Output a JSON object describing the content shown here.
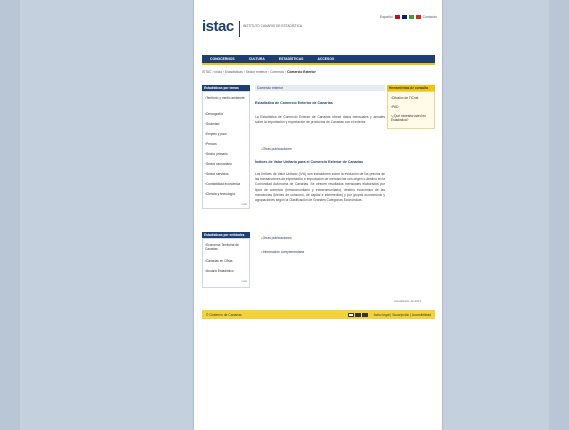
{
  "header": {
    "logo": "istac",
    "institute": "INSTITUTO CANARIO DE ESTADÍSTICA",
    "lang_links": "Español",
    "contact": "Contacto"
  },
  "topnav": [
    "Conocernos",
    "Cultura",
    "Estadísticas",
    "Accesos"
  ],
  "breadcrumb": {
    "trail": "ISTAC › Inicio › Estadísticas › Sector exterior › Comercio ›",
    "current": "Comercio Exterior"
  },
  "left_sidebar": {
    "header": "Estadísticas por temas",
    "items": [
      "Territorio y medio ambiente",
      "Demografía",
      "Sociedad",
      "Empleo y paro",
      "Precios",
      "Sector primario",
      "Sector secundario",
      "Sector servicios",
      "Contabilidad económica",
      "Ciencia y tecnología"
    ],
    "more": "más",
    "header2": "Estadísticas por entidades",
    "items2": [
      "Economía Territorial de Canarias",
      "Canarias en Cifras",
      "Anuario Estadístico"
    ],
    "more2": "más"
  },
  "main": {
    "section_header": "Comercio exterior",
    "title1": "Estadística de Comercio Exterior de Canarias",
    "para1": "La Estadística de Comercio Exterior de Canarias ofrece datos mensuales y anuales sobre la importación y exportación de productos de Canarias con el exterior.",
    "link1": "Otras publicaciones",
    "title2": "Índices de Valor Unitario para el Comercio Exterior de Canarias",
    "para2": "Los Índices de Valor Unitario (IVU) son indicadores sobre la evolución de los precios de las transacciones de exportación e importación de mercancías con origen o destino en la Comunidad Autónoma de Canarias. Se ofrecen resultados mensuales elaborados por tipos de comercio (intracomunitario y extracomunitario), destino económico de las mercancías (bienes de consumo, de capital e intermedios) y por grupos económicos y agrupaciones según la Clasificación de Grandes Categorías Económicas.",
    "link2": "Otras publicaciones",
    "link3": "Información complementaria"
  },
  "right_sidebar": {
    "header": "Herramientas de consulta",
    "items": [
      "Difusión de TICnet",
      "PAD",
      "¿Qué necesita usted en Estadística?"
    ]
  },
  "updated": "Actualizado 12-2012",
  "footer": {
    "left": "© Gobierno de Canarias",
    "right": "Aviso legal | Suscripción | Accesibilidad"
  },
  "colors": {
    "brand": "#1d3f73",
    "accent": "#f3c400",
    "background": "#b9c6d6"
  }
}
